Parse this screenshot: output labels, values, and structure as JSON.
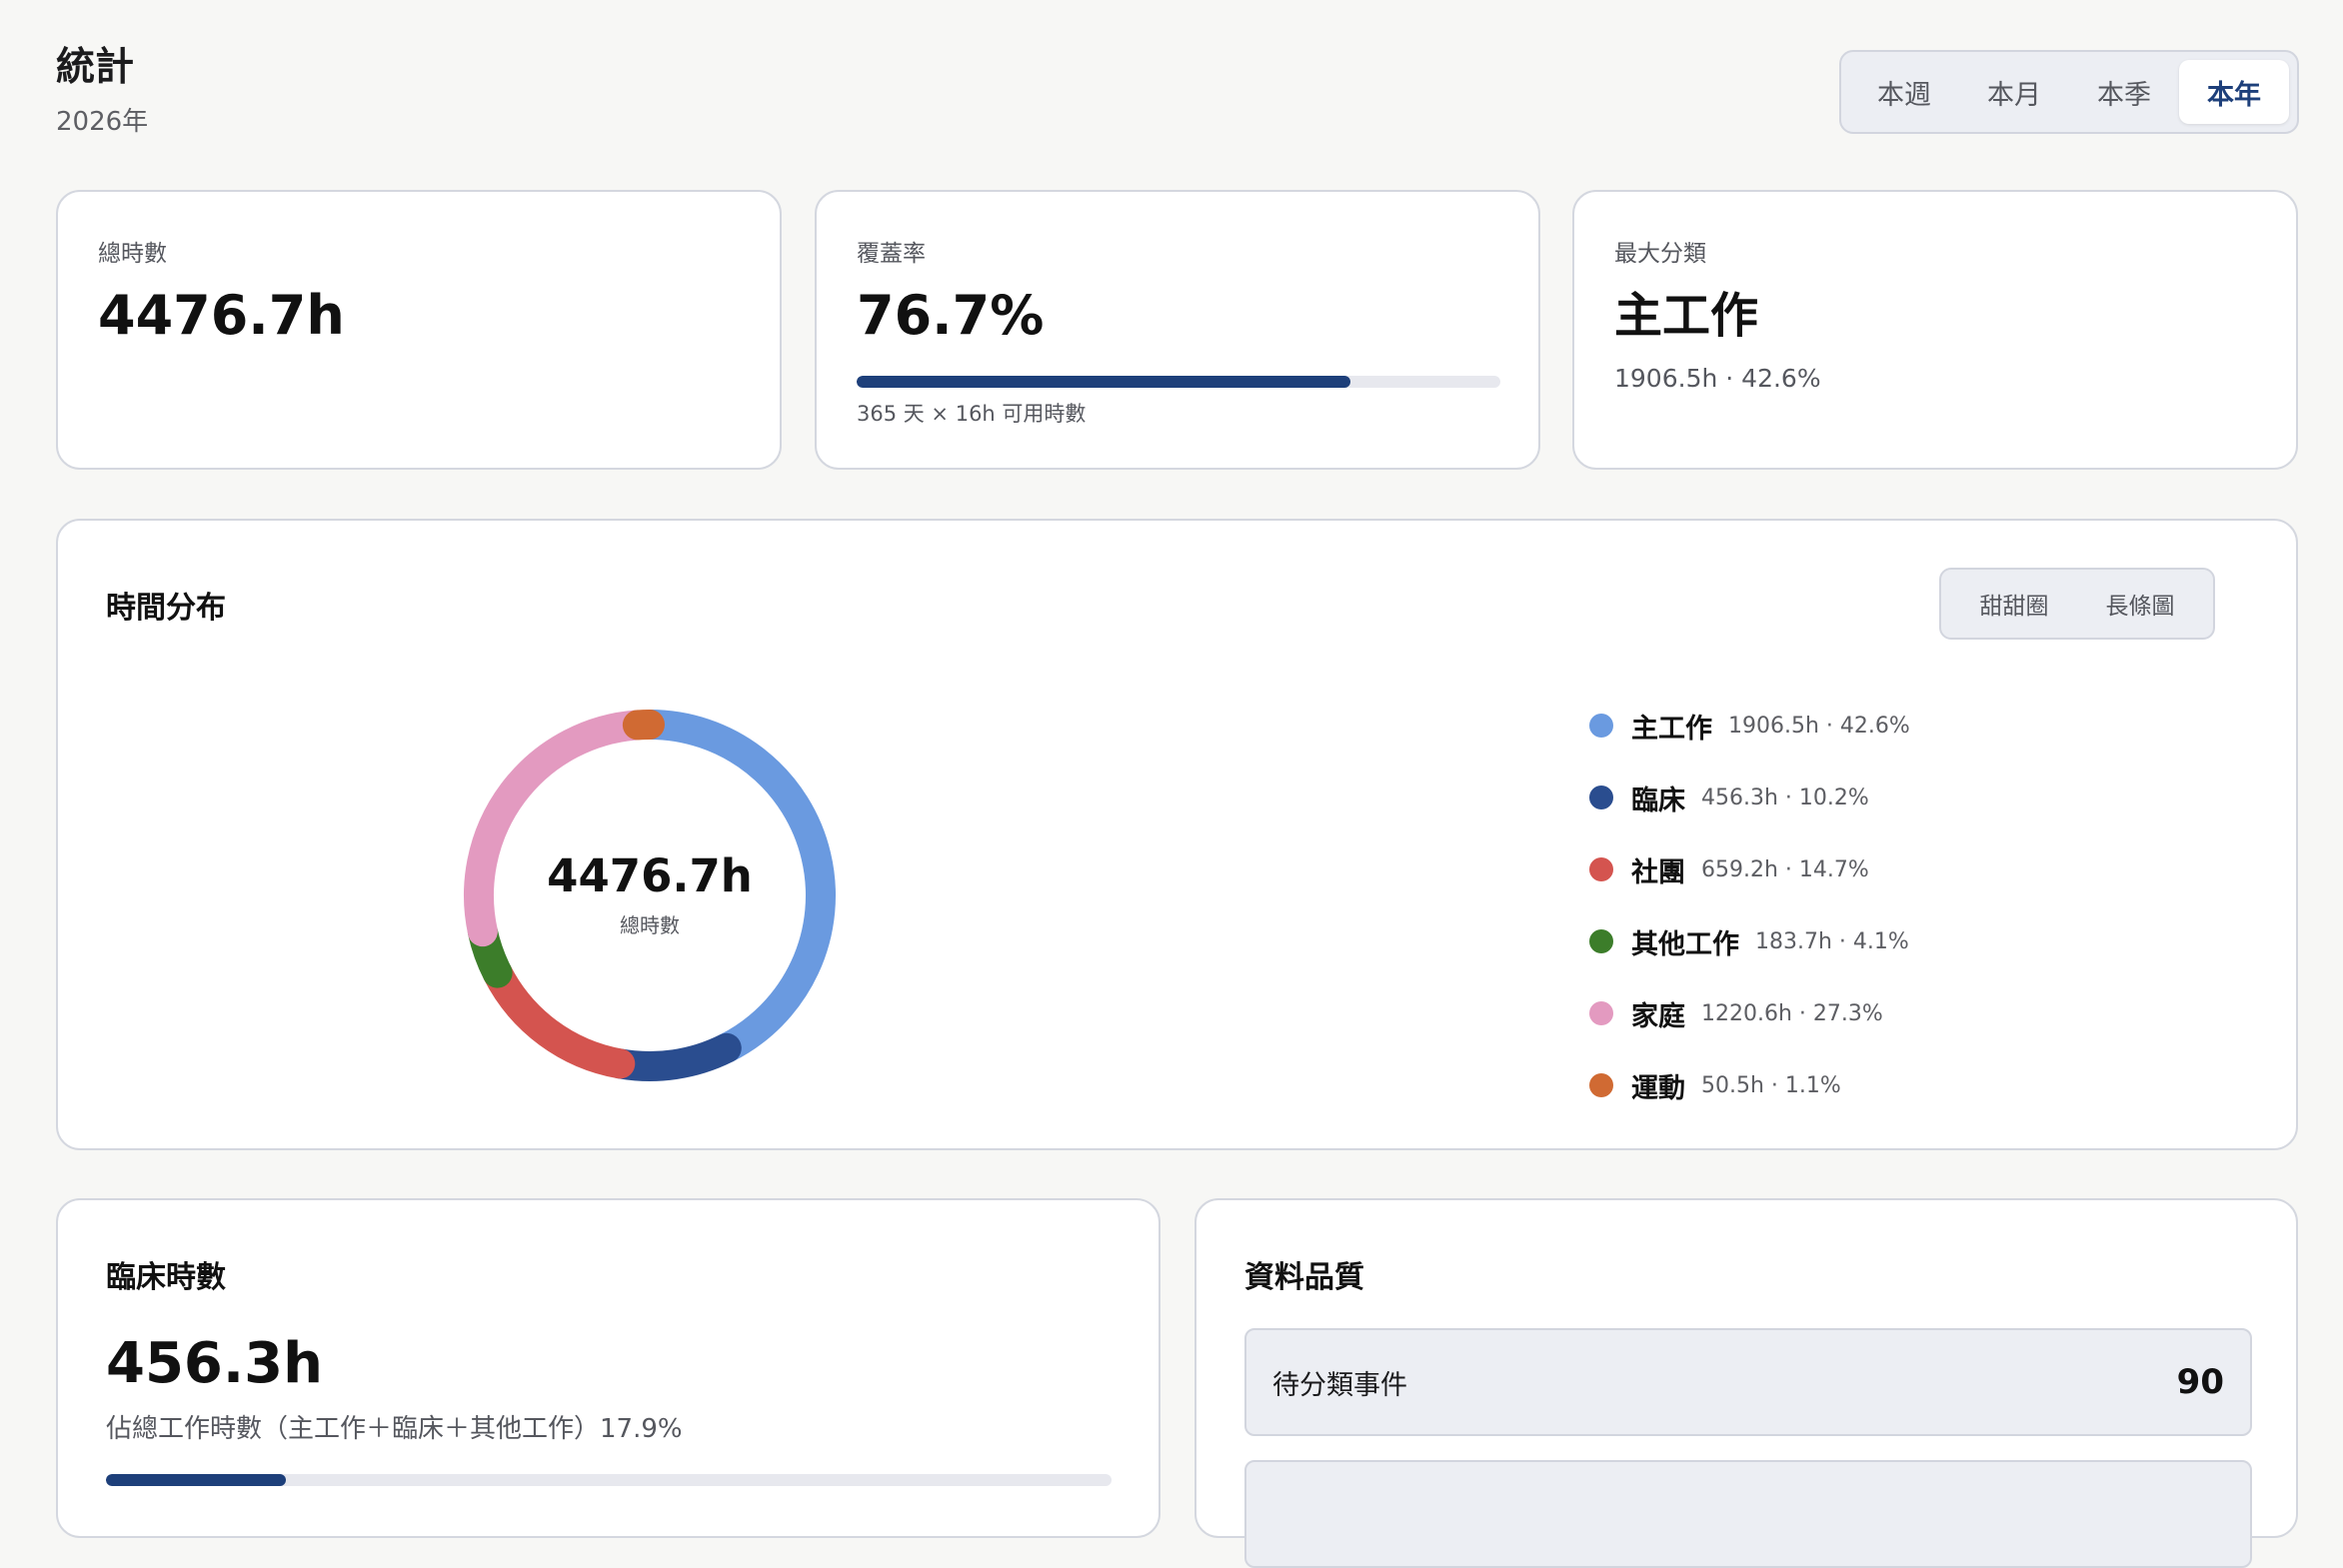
{
  "header": {
    "title": "統計",
    "subtitle": "2026年",
    "periods": [
      "本週",
      "本月",
      "本季",
      "本年"
    ],
    "active_period": "本年"
  },
  "stats": {
    "total": {
      "label": "總時數",
      "value": "4476.7h"
    },
    "coverage": {
      "label": "覆蓋率",
      "value": "76.7%",
      "progress": 0.767,
      "note": "365 天 × 16h 可用時數"
    },
    "top_category": {
      "label": "最大分類",
      "value": "主工作",
      "note": "1906.5h · 42.6%"
    }
  },
  "distribution": {
    "title": "時間分布",
    "view_options": [
      "甜甜圈",
      "長條圖"
    ],
    "center_value": "4476.7h",
    "center_label": "總時數",
    "categories": [
      {
        "name": "主工作",
        "meta": "1906.5h · 42.6%",
        "color": "#6a9ae0"
      },
      {
        "name": "臨床",
        "meta": "456.3h · 10.2%",
        "color": "#2a4d8f"
      },
      {
        "name": "社團",
        "meta": "659.2h · 14.7%",
        "color": "#d4544f"
      },
      {
        "name": "其他工作",
        "meta": "183.7h · 4.1%",
        "color": "#3c7d2a"
      },
      {
        "name": "家庭",
        "meta": "1220.6h · 27.3%",
        "color": "#e39ac0"
      },
      {
        "name": "運動",
        "meta": "50.5h · 1.1%",
        "color": "#d06a33"
      }
    ]
  },
  "chart_data": {
    "type": "pie",
    "categories": [
      "主工作",
      "臨床",
      "社團",
      "其他工作",
      "家庭",
      "運動"
    ],
    "values": [
      1906.5,
      456.3,
      659.2,
      183.7,
      1220.6,
      50.5
    ],
    "colors": [
      "#6a9ae0",
      "#2a4d8f",
      "#d4544f",
      "#3c7d2a",
      "#e39ac0",
      "#d06a33"
    ]
  },
  "clinical": {
    "title": "臨床時數",
    "value": "456.3h",
    "share_text": "佔總工作時數（主工作＋臨床＋其他工作）17.9%",
    "progress": 0.179
  },
  "quality": {
    "title": "資料品質",
    "rows": [
      {
        "label": "待分類事件",
        "value": "90"
      },
      {
        "label": "",
        "value": ""
      }
    ]
  }
}
